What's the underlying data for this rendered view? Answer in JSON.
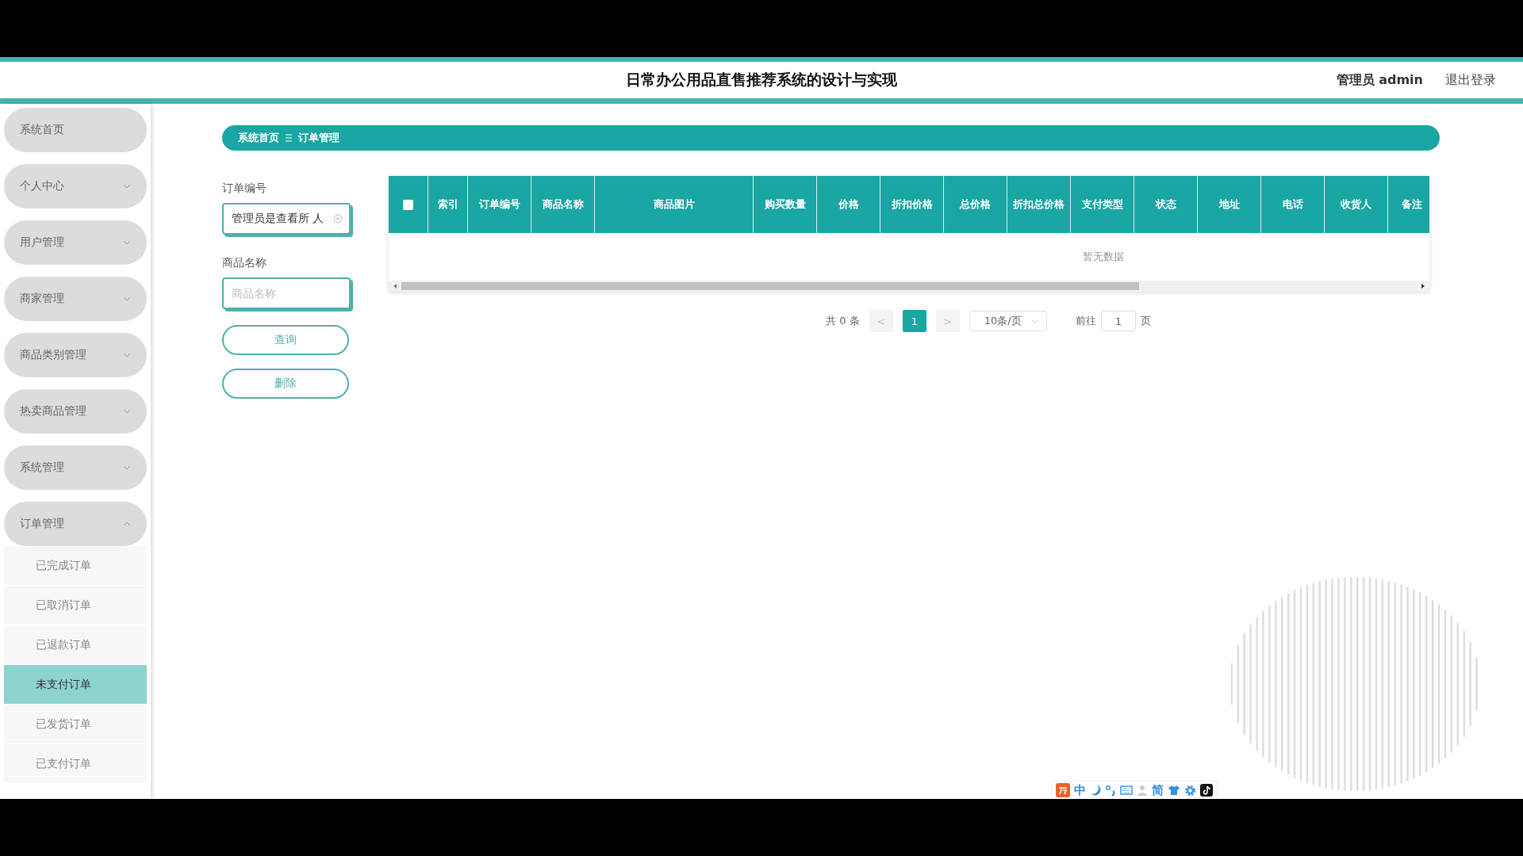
{
  "header": {
    "title": "日常办公用品直售推荐系统的设计与实现",
    "user": "管理员 admin",
    "logout": "退出登录"
  },
  "sidebar": {
    "items": [
      {
        "label": "系统首页",
        "expandable": false
      },
      {
        "label": "个人中心",
        "expandable": true,
        "expanded": false
      },
      {
        "label": "用户管理",
        "expandable": true,
        "expanded": false
      },
      {
        "label": "商家管理",
        "expandable": true,
        "expanded": false
      },
      {
        "label": "商品类别管理",
        "expandable": true,
        "expanded": false
      },
      {
        "label": "热卖商品管理",
        "expandable": true,
        "expanded": false
      },
      {
        "label": "系统管理",
        "expandable": true,
        "expanded": false
      },
      {
        "label": "订单管理",
        "expandable": true,
        "expanded": true,
        "children": [
          {
            "label": "已完成订单",
            "selected": false
          },
          {
            "label": "已取消订单",
            "selected": false
          },
          {
            "label": "已退款订单",
            "selected": false
          },
          {
            "label": "未支付订单",
            "selected": true
          },
          {
            "label": "已发货订单",
            "selected": false
          },
          {
            "label": "已支付订单",
            "selected": false
          }
        ]
      }
    ]
  },
  "breadcrumb": [
    "系统首页",
    "订单管理"
  ],
  "search": {
    "fields": [
      {
        "label": "订单编号",
        "value": "管理员是查看所 人",
        "clearable": true
      },
      {
        "label": "商品名称",
        "placeholder": "商品名称",
        "clearable": false
      }
    ],
    "buttons": [
      "查询",
      "删除"
    ]
  },
  "table": {
    "select_all_checked": false,
    "columns": [
      "索引",
      "订单编号",
      "商品名称",
      "商品图片",
      "购买数量",
      "价格",
      "折扣价格",
      "总价格",
      "折扣总价格",
      "支付类型",
      "状态",
      "地址",
      "电话",
      "收货人",
      "备注"
    ],
    "empty_text": "暂无数据"
  },
  "pagination": {
    "total": "共 0 条",
    "prev": "<",
    "pages": [
      {
        "label": "1",
        "selected": true
      }
    ],
    "next": ">",
    "page_size": "10条/页",
    "goto_label": "前往",
    "goto_value": "1",
    "page_unit": "页"
  },
  "ime_toolbar": {
    "mode": "中",
    "charset": "简"
  }
}
